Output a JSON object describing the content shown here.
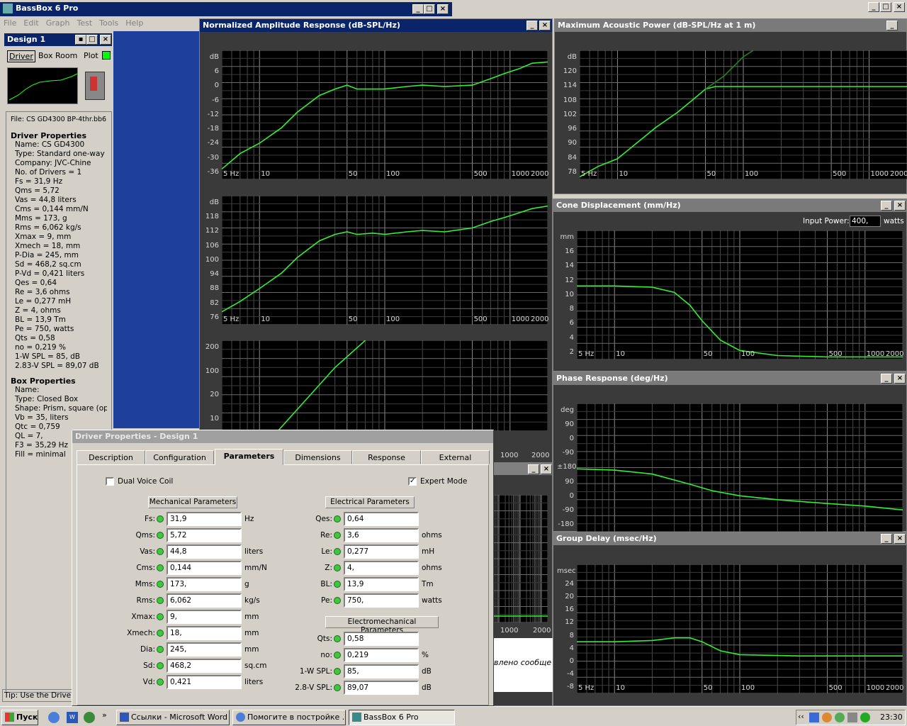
{
  "app": {
    "title": "BassBox 6 Pro"
  },
  "menu": [
    "File",
    "Edit",
    "Graph",
    "Test",
    "Tools",
    "Help"
  ],
  "design": {
    "title": "Design 1",
    "tabs": [
      "Driver",
      "Box",
      "Room",
      "Plot"
    ],
    "file": "File: CS GD4300 BP-4thr.bb6",
    "driver_header": "Driver Properties",
    "driver_lines": [
      "Name: CS GD4300",
      "Type: Standard one-way driver",
      "Company: JVC-Chine",
      "No. of Drivers = 1",
      "Fs = 31,9 Hz",
      "Qms = 5,72",
      "Vas = 44,8 liters",
      "Cms = 0,144 mm/N",
      "Mms = 173, g",
      "Rms = 6,062 kg/s",
      "Xmax = 9, mm",
      "Xmech = 18, mm",
      "P-Dia = 245, mm",
      "Sd = 468,2 sq.cm",
      "P-Vd = 0,421 liters",
      "Qes = 0,64",
      "Re = 3,6 ohms",
      "Le = 0,277 mH",
      "Z = 4, ohms",
      "BL = 13,9 Tm",
      "Pe = 750, watts",
      "Qts = 0,58",
      "no = 0,219 %",
      "1-W SPL = 85, dB",
      "2.83-V SPL = 89,07 dB"
    ],
    "box_header": "Box Properties",
    "box_lines": [
      "Name:",
      "Type: Closed Box",
      "Shape: Prism, square (optimum)",
      "Vb = 35, liters",
      "Qtc = 0,759",
      "QL = 7,",
      "F3 = 35,29 Hz",
      "Fill = minimal"
    ],
    "tip": "Tip: Use the Driver Properties"
  },
  "graphs": {
    "amp_title": "Normalized Amplitude Response (dB-SPL/Hz)",
    "amp_y": [
      "dB",
      "6",
      "0",
      "-6",
      "-12",
      "-18",
      "-24",
      "-30",
      "-36"
    ],
    "spl_y": [
      "dB",
      "118",
      "112",
      "106",
      "100",
      "94",
      "88",
      "82",
      "76"
    ],
    "imp_y": [
      "200",
      "100",
      "20",
      "10"
    ],
    "map_title": "Maximum Acoustic Power (dB-SPL/Hz at 1 m)",
    "map_y": [
      "dB",
      "120",
      "114",
      "108",
      "102",
      "96",
      "90",
      "84",
      "78"
    ],
    "cone_title": "Cone Displacement (mm/Hz)",
    "cone_y": [
      "mm",
      "16",
      "14",
      "12",
      "10",
      "8",
      "6",
      "4",
      "2"
    ],
    "input_power_label": "Input Power:",
    "input_power_value": "400,",
    "input_power_unit": "watts",
    "phase_title": "Phase Response (deg/Hz)",
    "phase_y": [
      "deg",
      "90",
      "0",
      "-90",
      "±180",
      "90",
      "0",
      "-90",
      "-180"
    ],
    "gd_title": "Group Delay (msec/Hz)",
    "gd_y": [
      "msec",
      "24",
      "20",
      "16",
      "12",
      "8",
      "4",
      "0",
      "-4",
      "-8"
    ],
    "x_ticks": [
      "5 Hz",
      "10",
      "50",
      "100",
      "500",
      "1000",
      "2000"
    ],
    "x_ticks_partial": [
      "1000",
      "2000"
    ],
    "behind_text": "влено сообще"
  },
  "dialog": {
    "title": "Driver Properties - Design 1",
    "tabs": [
      "Description",
      "Configuration",
      "Parameters",
      "Dimensions",
      "Response",
      "External"
    ],
    "dual_voice_coil": "Dual Voice Coil",
    "expert_mode": "Expert Mode",
    "mech_header": "Mechanical Parameters",
    "elec_header": "Electrical Parameters",
    "em_header": "Electromechanical Parameters",
    "mech": [
      {
        "label": "Fs:",
        "value": "31,9",
        "unit": "Hz"
      },
      {
        "label": "Qms:",
        "value": "5,72",
        "unit": ""
      },
      {
        "label": "Vas:",
        "value": "44,8",
        "unit": "liters"
      },
      {
        "label": "Cms:",
        "value": "0,144",
        "unit": "mm/N"
      },
      {
        "label": "Mms:",
        "value": "173,",
        "unit": "g"
      },
      {
        "label": "Rms:",
        "value": "6,062",
        "unit": "kg/s"
      },
      {
        "label": "Xmax:",
        "value": "9,",
        "unit": "mm"
      },
      {
        "label": "Xmech:",
        "value": "18,",
        "unit": "mm"
      },
      {
        "label": "Dia:",
        "value": "245,",
        "unit": "mm"
      },
      {
        "label": "Sd:",
        "value": "468,2",
        "unit": "sq.cm"
      },
      {
        "label": "Vd:",
        "value": "0,421",
        "unit": "liters"
      }
    ],
    "elec": [
      {
        "label": "Qes:",
        "value": "0,64",
        "unit": ""
      },
      {
        "label": "Re:",
        "value": "3,6",
        "unit": "ohms"
      },
      {
        "label": "Le:",
        "value": "0,277",
        "unit": "mH"
      },
      {
        "label": "Z:",
        "value": "4,",
        "unit": "ohms"
      },
      {
        "label": "BL:",
        "value": "13,9",
        "unit": "Tm"
      },
      {
        "label": "Pe:",
        "value": "750,",
        "unit": "watts"
      }
    ],
    "em": [
      {
        "label": "Qts:",
        "value": "0,58",
        "unit": ""
      },
      {
        "label": "no:",
        "value": "0,219",
        "unit": "%"
      },
      {
        "label": "1-W SPL:",
        "value": "85,",
        "unit": "dB"
      },
      {
        "label": "2.8-V SPL:",
        "value": "89,07",
        "unit": "dB"
      }
    ]
  },
  "taskbar": {
    "start": "Пуск",
    "tasks": [
      "Ссылки - Microsoft Word",
      "Помогите в постройке ...",
      "BassBox 6 Pro"
    ],
    "clock": "23:30"
  }
}
